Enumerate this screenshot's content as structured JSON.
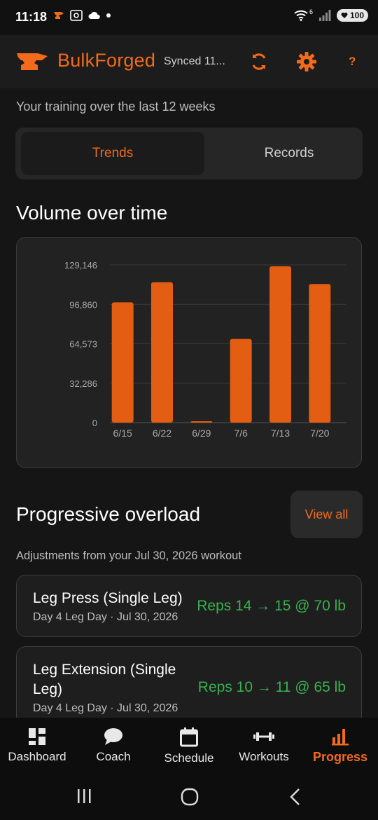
{
  "status_bar": {
    "time": "11:18",
    "network_badge": "6",
    "battery": "100"
  },
  "header": {
    "brand": "BulkForged",
    "sync_status": "Synced 11...",
    "help_label": "?",
    "icons": {
      "logo": "anvil-icon",
      "sync": "sync-icon",
      "settings": "gear-icon"
    }
  },
  "subtitle": "Your training over the last 12 weeks",
  "tabs": [
    {
      "label": "Trends",
      "selected": true
    },
    {
      "label": "Records",
      "selected": false
    }
  ],
  "volume_section": {
    "title": "Volume over time"
  },
  "chart_data": {
    "type": "bar",
    "title": "Volume over time",
    "categories": [
      "6/15",
      "6/22",
      "6/29",
      "7/6",
      "7/13",
      "7/20"
    ],
    "values": [
      98500,
      115000,
      900,
      68500,
      128000,
      113500
    ],
    "y_ticks": [
      "0",
      "32,286",
      "64,573",
      "96,860",
      "129,146"
    ],
    "ylim": [
      0,
      129146
    ],
    "grid": true,
    "bar_color": "#e35d13"
  },
  "overload_section": {
    "title": "Progressive overload",
    "view_all_label": "View all",
    "caption": "Adjustments from your Jul 30, 2026 workout",
    "items": [
      {
        "name": "Leg Press (Single Leg)",
        "meta": "Day 4 Leg Day · Jul 30, 2026",
        "adjustment": "Reps 14 → 15 @ 70 lb"
      },
      {
        "name": "Leg Extension (Single Leg)",
        "meta": "Day 4 Leg Day · Jul 30, 2026",
        "adjustment": "Reps 10 → 11 @ 65 lb"
      }
    ]
  },
  "bottom_nav": [
    {
      "label": "Dashboard",
      "icon": "dashboard-icon",
      "active": false
    },
    {
      "label": "Coach",
      "icon": "chat-bubble-icon",
      "active": false
    },
    {
      "label": "Schedule",
      "icon": "calendar-icon",
      "active": false
    },
    {
      "label": "Workouts",
      "icon": "dumbbell-icon",
      "active": false
    },
    {
      "label": "Progress",
      "icon": "bar-chart-icon",
      "active": true
    }
  ],
  "colors": {
    "accent": "#f26a1b",
    "positive": "#37b24d",
    "background": "#151515",
    "card": "#222222"
  }
}
